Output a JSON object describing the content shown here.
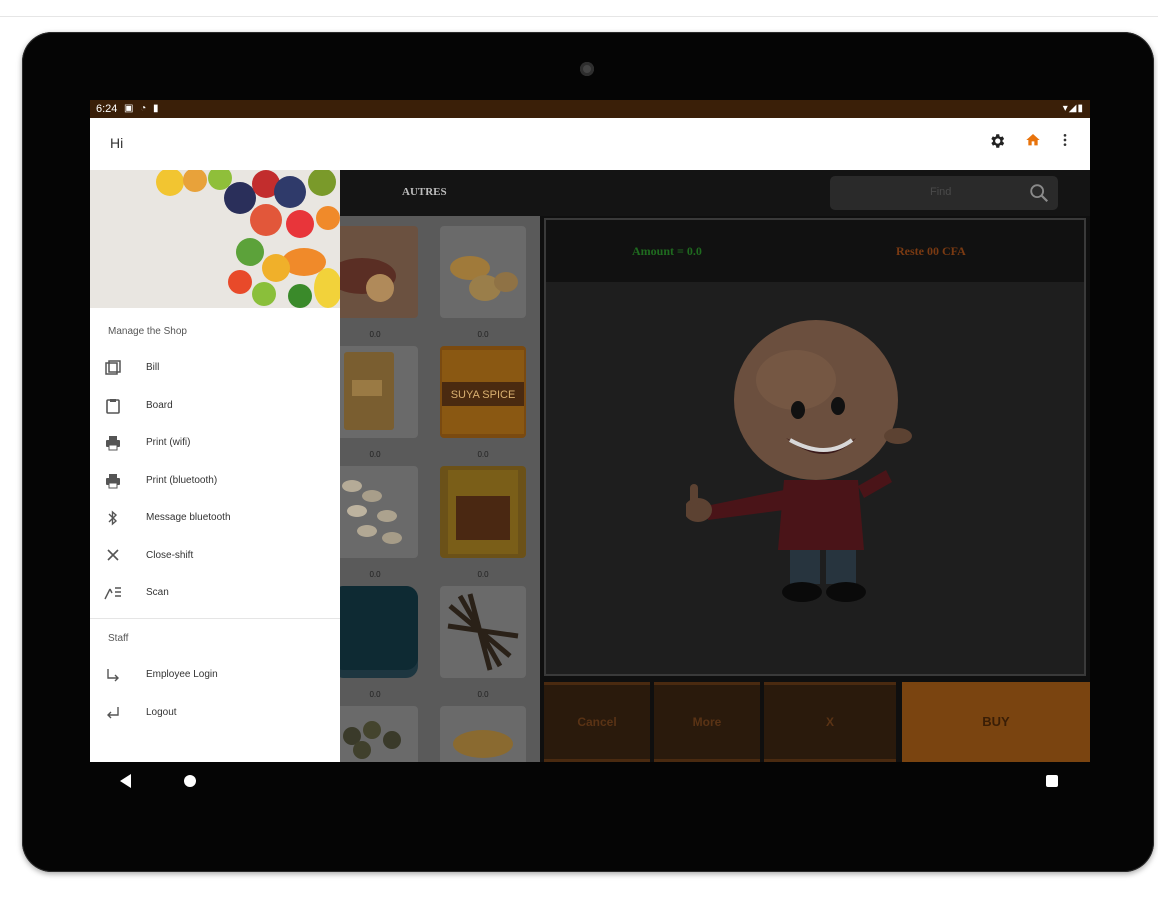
{
  "status_bar": {
    "time": "6:24",
    "left_icons": "▣ ◔ ▮",
    "right_icons": "▾◢▮"
  },
  "app_bar": {
    "title": "Hi",
    "settings_icon": "gear-icon",
    "home_icon": "home-icon",
    "overflow_icon": "more-vert-icon",
    "home_color": "#e8730c"
  },
  "tabs": {
    "autres": "AUTRES"
  },
  "search": {
    "placeholder": "Find"
  },
  "products": {
    "prices": [
      "0.0",
      "0.0",
      "0.0",
      "0.0",
      "0.0",
      "0.0",
      "0.0",
      "0.0"
    ]
  },
  "cart": {
    "amount": "Amount = 0.0",
    "reste": "Reste 00 CFA"
  },
  "buttons": {
    "cancel": "Cancel",
    "more": "More",
    "x": "X",
    "buy": "BUY"
  },
  "drawer": {
    "section_shop": "Manage the Shop",
    "items": [
      {
        "label": "Bill",
        "icon": "bill-icon"
      },
      {
        "label": "Board",
        "icon": "clipboard-icon"
      },
      {
        "label": "Print (wifi)",
        "icon": "printer-icon"
      },
      {
        "label": "Print (bluetooth)",
        "icon": "printer-icon"
      },
      {
        "label": "Message bluetooth",
        "icon": "bluetooth-icon"
      },
      {
        "label": "Close-shift",
        "icon": "close-icon"
      },
      {
        "label": "Scan",
        "icon": "scan-icon"
      }
    ],
    "section_staff": "Staff",
    "staff_items": [
      {
        "label": "Employee Login",
        "icon": "login-icon"
      },
      {
        "label": "Logout",
        "icon": "logout-icon"
      }
    ]
  },
  "colors": {
    "accent": "#e8730c",
    "status_bar": "#3a1f08",
    "buy_button": "#7a4410"
  }
}
